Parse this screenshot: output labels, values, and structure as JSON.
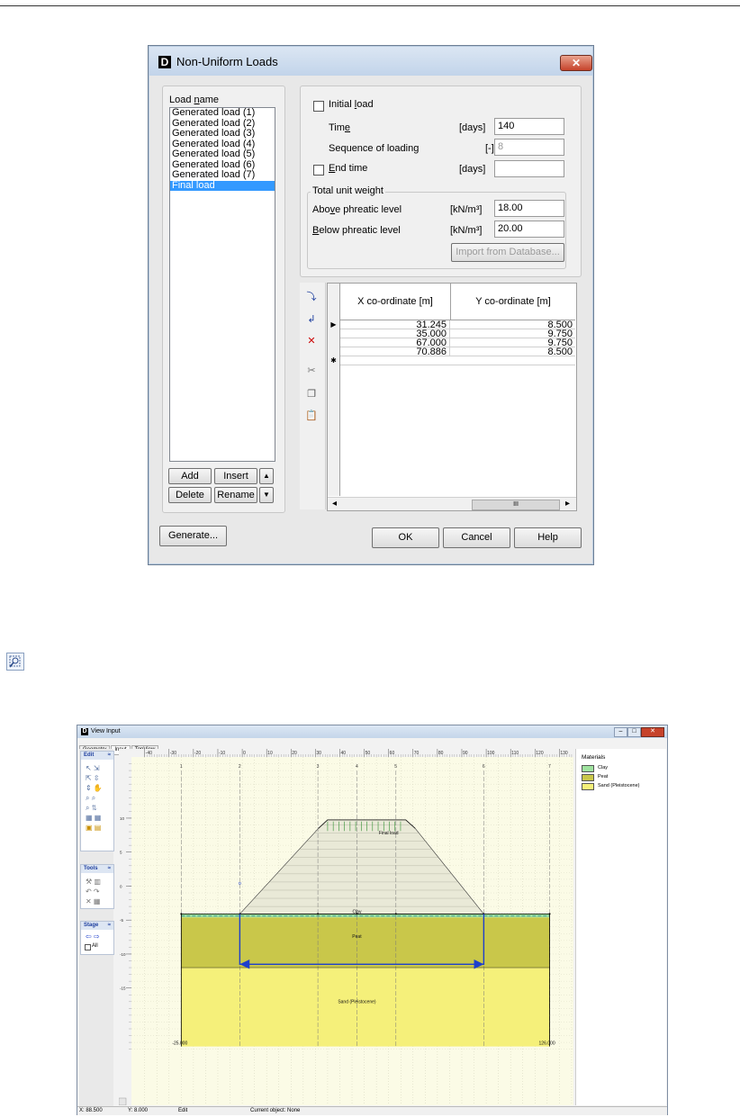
{
  "dialog": {
    "title": "Non-Uniform Loads",
    "icon_letter": "D",
    "close_glyph": "✕",
    "load_name_label_pre": "Load ",
    "load_name_label_u": "n",
    "load_name_label_post": "ame",
    "loads": [
      "Generated load (1)",
      "Generated load (2)",
      "Generated load (3)",
      "Generated load (4)",
      "Generated load (5)",
      "Generated load (6)",
      "Generated load (7)",
      "Final load"
    ],
    "selected_load": "Final load",
    "buttons": {
      "add": "Add",
      "insert": "Insert",
      "delete": "Delete",
      "rename": "Rename",
      "up": "▲",
      "down": "▼",
      "generate": "Generate...",
      "ok": "OK",
      "cancel": "Cancel",
      "help": "Help",
      "import": "Import from Database..."
    },
    "initial_load": {
      "label_pre": "Initial ",
      "label_u": "l",
      "label_post": "oad",
      "checked": false
    },
    "time": {
      "label_pre": "Tim",
      "label_u": "e",
      "unit": "[days]",
      "value": "140"
    },
    "sequence": {
      "label": "Sequence of loading",
      "unit": "[-]",
      "value": "8"
    },
    "end_time": {
      "label_u": "E",
      "label_post": "nd time",
      "unit": "[days]",
      "value": "",
      "checked": false
    },
    "unit_weight": {
      "group_label": "Total unit weight",
      "above_label_pre": "Abo",
      "above_label_u": "v",
      "above_label_post": "e phreatic level",
      "above_unit": "[kN/m³]",
      "above_value": "18.00",
      "below_label_u": "B",
      "below_label_post": "elow phreatic level",
      "below_unit": "[kN/m³]",
      "below_value": "20.00"
    },
    "grid": {
      "col_x": "X co-ordinate [m]",
      "col_y": "Y co-ordinate [m]",
      "rows": [
        [
          "31.245",
          "8.500"
        ],
        [
          "35.000",
          "9.750"
        ],
        [
          "67.000",
          "9.750"
        ],
        [
          "70.886",
          "8.500"
        ]
      ],
      "new_row_marker": "✱",
      "current_row_marker": "▶",
      "scroll_left": "◂",
      "scroll_right": "▸",
      "scroll_thumb": "III"
    }
  },
  "view_input": {
    "title": "View Input",
    "tabs": [
      "Geometry",
      "Input",
      "TopView"
    ],
    "active_tab": "Input",
    "sidebar": {
      "edit_header": "Edit",
      "tools_header": "Tools",
      "stage_header": "Stage",
      "all_label": "All",
      "collapse_glyph": "≈"
    },
    "ruler_x_labels": [
      "-40",
      "-30",
      "-20",
      "-10",
      "0",
      "10",
      "20",
      "30",
      "40",
      "50",
      "60",
      "70",
      "80",
      "90",
      "100",
      "110",
      "120",
      "130"
    ],
    "ruler_y_labels": [
      "10",
      "5",
      "0",
      "-5",
      "-10",
      "-15"
    ],
    "vertical_line_labels": [
      "1",
      "2",
      "3",
      "4",
      "5",
      "6",
      "7"
    ],
    "layer_labels": {
      "clay": "Clay",
      "peat": "Peat",
      "sand": "Sand (Pleistocene)"
    },
    "load_label": "Final load",
    "bottom_left_coord": "-25.000",
    "bottom_right_coord": "126.000",
    "legend": {
      "title": "Materials",
      "items": [
        {
          "name": "Clay",
          "color": "#9fe39f"
        },
        {
          "name": "Peat",
          "color": "#c9c74a"
        },
        {
          "name": "Sand (Pleistocene)",
          "color": "#f5f07a"
        }
      ]
    },
    "status": {
      "x": "X: 88.500",
      "y": "Y: 8.000",
      "mode": "Edit",
      "current": "Current object: None"
    },
    "colors": {
      "clay": "#9fe39f",
      "peat": "#c9c74a",
      "sand": "#f5f07a",
      "fill_bg": "#fbfbe6",
      "accent": "#1e3fcc"
    }
  }
}
